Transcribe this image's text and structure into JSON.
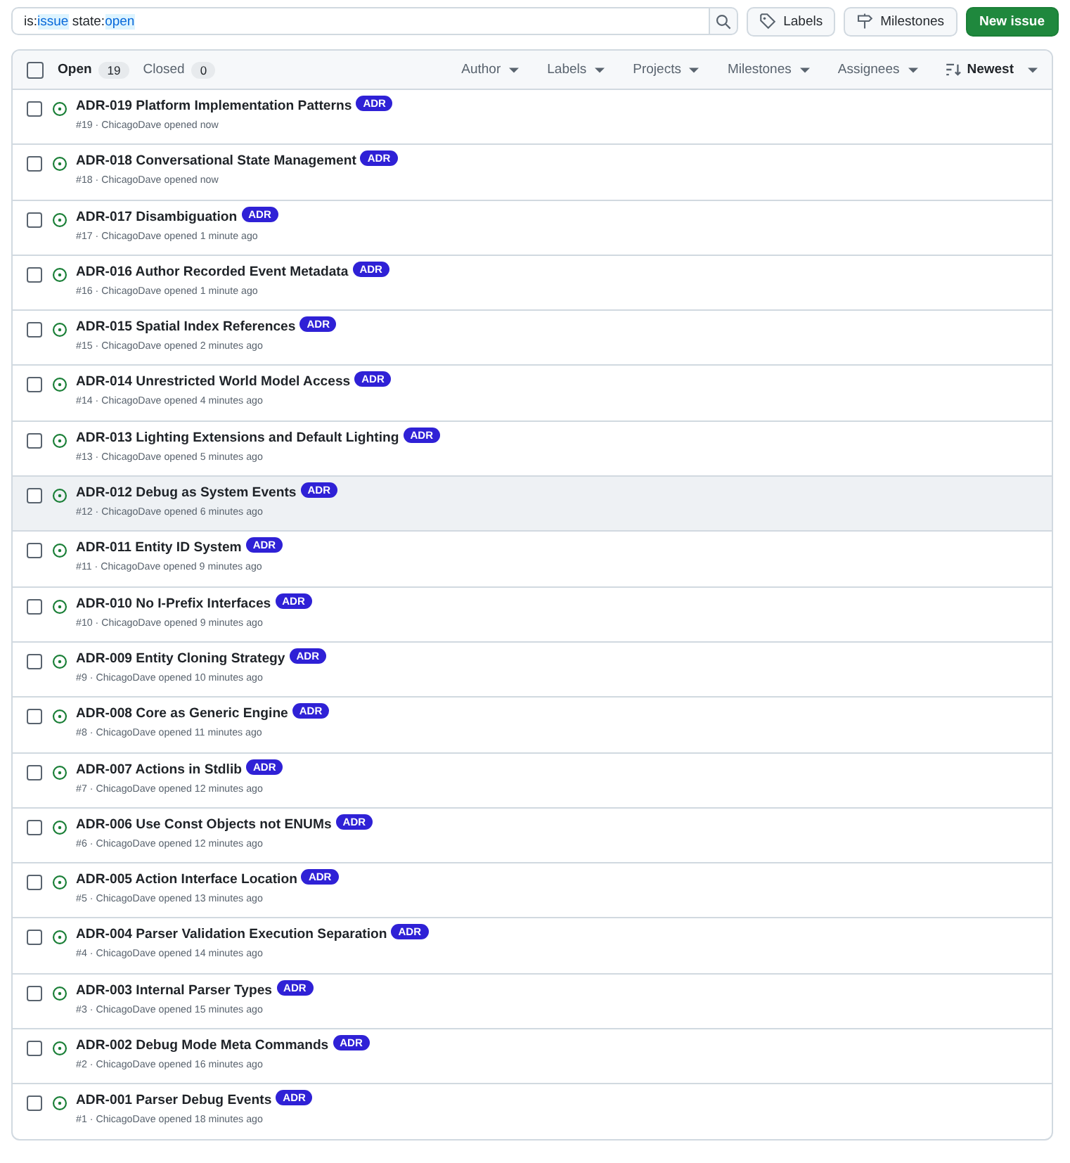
{
  "search": {
    "tokens": [
      {
        "qualifier": "is:",
        "value": "issue"
      },
      {
        "qualifier": "state:",
        "value": "open"
      }
    ]
  },
  "toolbar_buttons": [
    {
      "label": "Labels",
      "kind": "labels"
    },
    {
      "label": "Milestones",
      "kind": "milestones"
    }
  ],
  "new_issue_button": "New issue",
  "select_all_checked": false,
  "state_tabs": [
    {
      "label": "Open",
      "count": "19",
      "selected": true
    },
    {
      "label": "Closed",
      "count": "0",
      "selected": false
    }
  ],
  "filters": [
    {
      "label": "Author",
      "kind": "dropdown"
    },
    {
      "label": "Labels",
      "kind": "dropdown"
    },
    {
      "label": "Projects",
      "kind": "dropdown"
    },
    {
      "label": "Milestones",
      "kind": "dropdown"
    },
    {
      "label": "Assignees",
      "kind": "dropdown"
    },
    {
      "label": "Newest",
      "kind": "sort"
    }
  ],
  "issues": [
    {
      "title": "ADR-019 Platform Implementation Patterns",
      "label": "ADR",
      "meta": "#19 · ChicagoDave opened now",
      "checked": false,
      "hovered": false
    },
    {
      "title": "ADR-018 Conversational State Management",
      "label": "ADR",
      "meta": "#18 · ChicagoDave opened now",
      "checked": false,
      "hovered": false
    },
    {
      "title": "ADR-017 Disambiguation",
      "label": "ADR",
      "meta": "#17 · ChicagoDave opened 1 minute ago",
      "checked": false,
      "hovered": false
    },
    {
      "title": "ADR-016 Author Recorded Event Metadata",
      "label": "ADR",
      "meta": "#16 · ChicagoDave opened 1 minute ago",
      "checked": false,
      "hovered": false
    },
    {
      "title": "ADR-015 Spatial Index References",
      "label": "ADR",
      "meta": "#15 · ChicagoDave opened 2 minutes ago",
      "checked": false,
      "hovered": false
    },
    {
      "title": "ADR-014 Unrestricted World Model Access",
      "label": "ADR",
      "meta": "#14 · ChicagoDave opened 4 minutes ago",
      "checked": false,
      "hovered": false
    },
    {
      "title": "ADR-013 Lighting Extensions and Default Lighting",
      "label": "ADR",
      "meta": "#13 · ChicagoDave opened 5 minutes ago",
      "checked": false,
      "hovered": false
    },
    {
      "title": "ADR-012 Debug as System Events",
      "label": "ADR",
      "meta": "#12 · ChicagoDave opened 6 minutes ago",
      "checked": false,
      "hovered": true
    },
    {
      "title": "ADR-011 Entity ID System",
      "label": "ADR",
      "meta": "#11 · ChicagoDave opened 9 minutes ago",
      "checked": false,
      "hovered": false
    },
    {
      "title": "ADR-010 No I-Prefix Interfaces",
      "label": "ADR",
      "meta": "#10 · ChicagoDave opened 9 minutes ago",
      "checked": false,
      "hovered": false
    },
    {
      "title": "ADR-009 Entity Cloning Strategy",
      "label": "ADR",
      "meta": "#9 · ChicagoDave opened 10 minutes ago",
      "checked": false,
      "hovered": false
    },
    {
      "title": "ADR-008 Core as Generic Engine",
      "label": "ADR",
      "meta": "#8 · ChicagoDave opened 11 minutes ago",
      "checked": false,
      "hovered": false
    },
    {
      "title": "ADR-007 Actions in Stdlib",
      "label": "ADR",
      "meta": "#7 · ChicagoDave opened 12 minutes ago",
      "checked": false,
      "hovered": false
    },
    {
      "title": "ADR-006 Use Const Objects not ENUMs",
      "label": "ADR",
      "meta": "#6 · ChicagoDave opened 12 minutes ago",
      "checked": false,
      "hovered": false
    },
    {
      "title": "ADR-005 Action Interface Location",
      "label": "ADR",
      "meta": "#5 · ChicagoDave opened 13 minutes ago",
      "checked": false,
      "hovered": false
    },
    {
      "title": "ADR-004 Parser Validation Execution Separation",
      "label": "ADR",
      "meta": "#4 · ChicagoDave opened 14 minutes ago",
      "checked": false,
      "hovered": false
    },
    {
      "title": "ADR-003 Internal Parser Types",
      "label": "ADR",
      "meta": "#3 · ChicagoDave opened 15 minutes ago",
      "checked": false,
      "hovered": false
    },
    {
      "title": "ADR-002 Debug Mode Meta Commands",
      "label": "ADR",
      "meta": "#2 · ChicagoDave opened 16 minutes ago",
      "checked": false,
      "hovered": false
    },
    {
      "title": "ADR-001 Parser Debug Events",
      "label": "ADR",
      "meta": "#1 · ChicagoDave opened 18 minutes ago",
      "checked": false,
      "hovered": false
    }
  ]
}
